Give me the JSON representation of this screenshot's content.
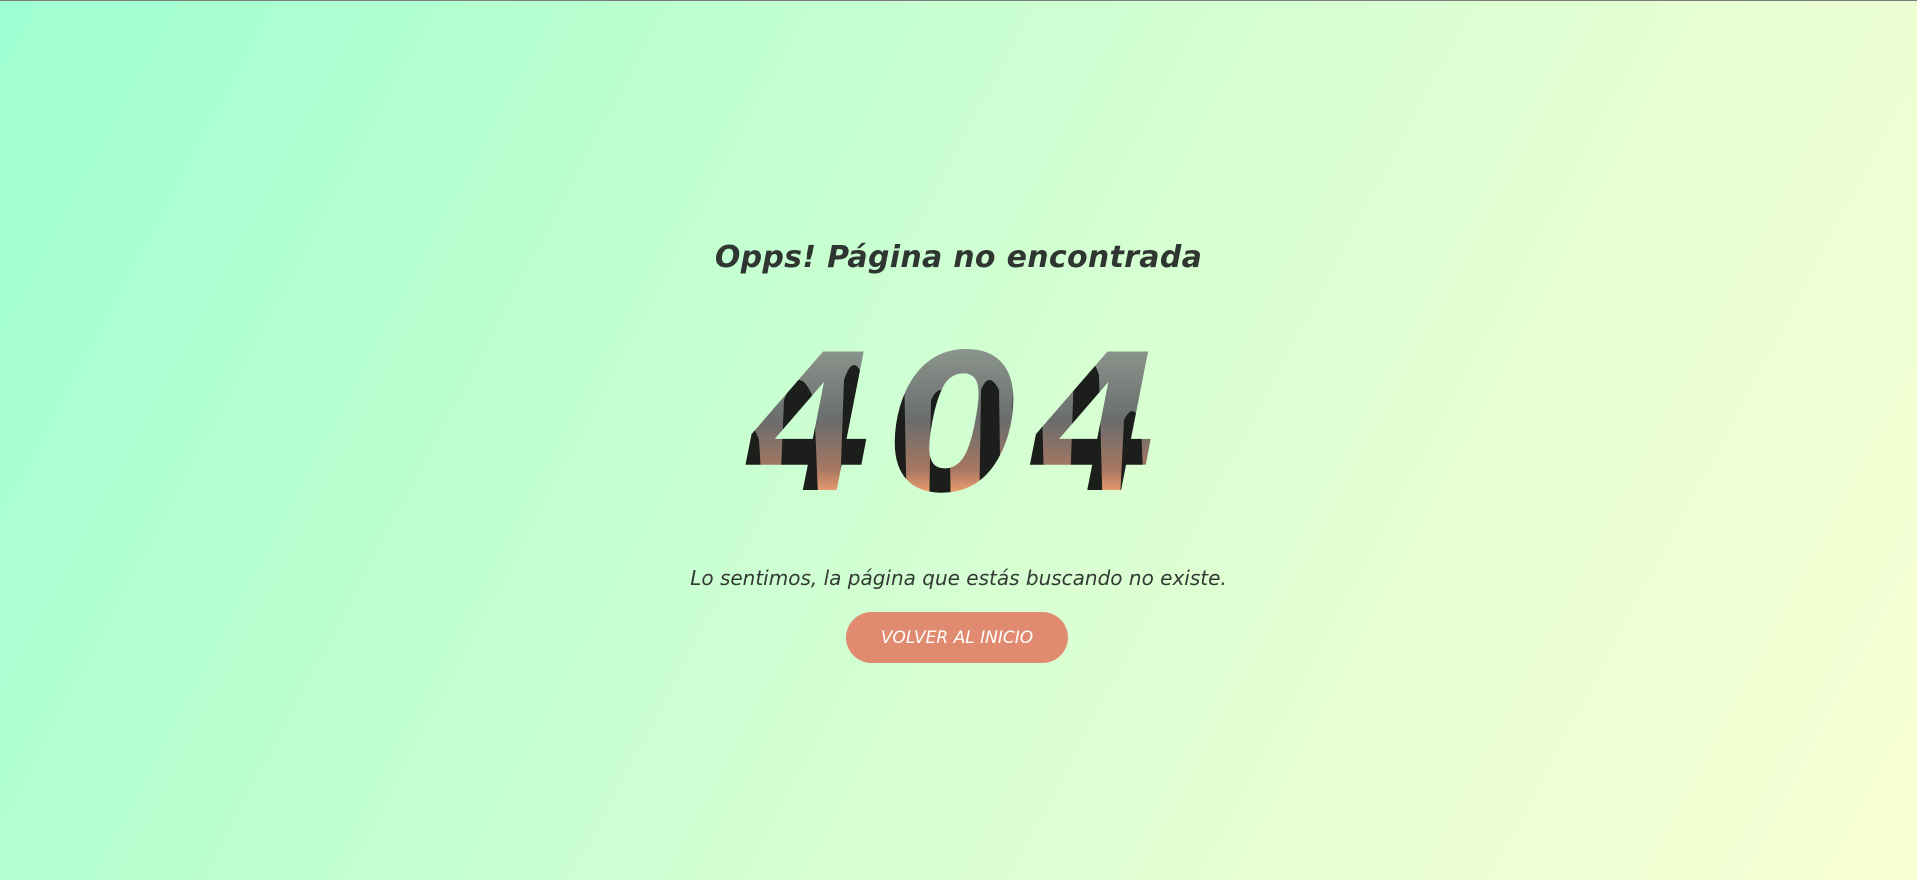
{
  "page": {
    "title": "Opps! Página no encontrada",
    "error_code": "404",
    "message": "Lo sentimos, la página que estás buscando no existe.",
    "home_button_label": "VOLVER AL INICIO"
  },
  "colors": {
    "background_start": "#9fffd2",
    "background_end": "#f8ffd4",
    "text": "#2f3530",
    "button": "#e08b70",
    "button_text": "#ffffff"
  }
}
